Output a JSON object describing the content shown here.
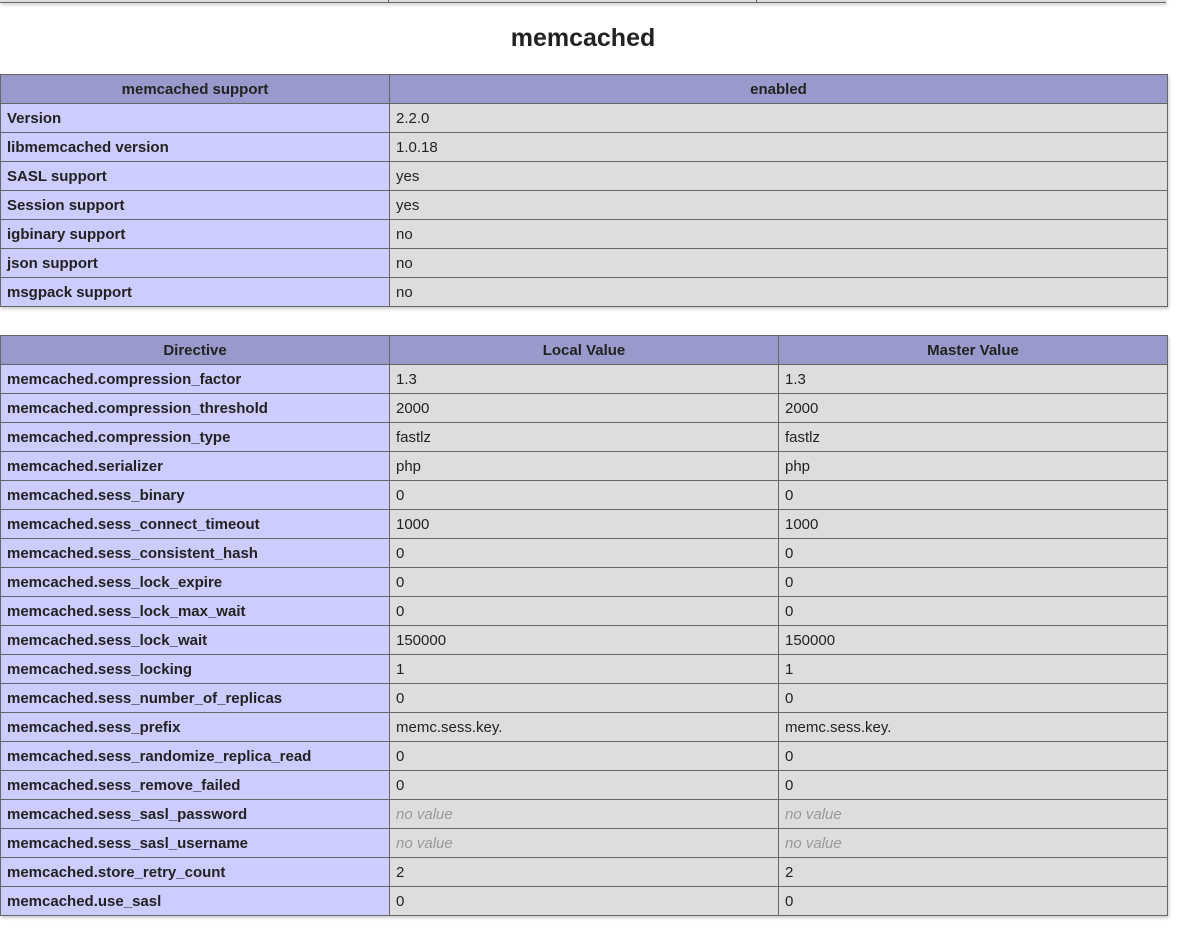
{
  "section_title": "memcached",
  "support_table": {
    "header": [
      "memcached support",
      "enabled"
    ],
    "rows": [
      {
        "name": "Version",
        "value": "2.2.0"
      },
      {
        "name": "libmemcached version",
        "value": "1.0.18"
      },
      {
        "name": "SASL support",
        "value": "yes"
      },
      {
        "name": "Session support",
        "value": "yes"
      },
      {
        "name": "igbinary support",
        "value": "no"
      },
      {
        "name": "json support",
        "value": "no"
      },
      {
        "name": "msgpack support",
        "value": "no"
      }
    ]
  },
  "directive_table": {
    "header": [
      "Directive",
      "Local Value",
      "Master Value"
    ],
    "rows": [
      {
        "directive": "memcached.compression_factor",
        "local": "1.3",
        "master": "1.3"
      },
      {
        "directive": "memcached.compression_threshold",
        "local": "2000",
        "master": "2000"
      },
      {
        "directive": "memcached.compression_type",
        "local": "fastlz",
        "master": "fastlz"
      },
      {
        "directive": "memcached.serializer",
        "local": "php",
        "master": "php"
      },
      {
        "directive": "memcached.sess_binary",
        "local": "0",
        "master": "0"
      },
      {
        "directive": "memcached.sess_connect_timeout",
        "local": "1000",
        "master": "1000"
      },
      {
        "directive": "memcached.sess_consistent_hash",
        "local": "0",
        "master": "0"
      },
      {
        "directive": "memcached.sess_lock_expire",
        "local": "0",
        "master": "0"
      },
      {
        "directive": "memcached.sess_lock_max_wait",
        "local": "0",
        "master": "0"
      },
      {
        "directive": "memcached.sess_lock_wait",
        "local": "150000",
        "master": "150000"
      },
      {
        "directive": "memcached.sess_locking",
        "local": "1",
        "master": "1"
      },
      {
        "directive": "memcached.sess_number_of_replicas",
        "local": "0",
        "master": "0"
      },
      {
        "directive": "memcached.sess_prefix",
        "local": "memc.sess.key.",
        "master": "memc.sess.key."
      },
      {
        "directive": "memcached.sess_randomize_replica_read",
        "local": "0",
        "master": "0"
      },
      {
        "directive": "memcached.sess_remove_failed",
        "local": "0",
        "master": "0"
      },
      {
        "directive": "memcached.sess_sasl_password",
        "local": "no value",
        "master": "no value"
      },
      {
        "directive": "memcached.sess_sasl_username",
        "local": "no value",
        "master": "no value"
      },
      {
        "directive": "memcached.store_retry_count",
        "local": "2",
        "master": "2"
      },
      {
        "directive": "memcached.use_sasl",
        "local": "0",
        "master": "0"
      }
    ]
  },
  "colors": {
    "header_bg": "#9999cc",
    "name_cell_bg": "#ccccff",
    "value_cell_bg": "#dddddd",
    "no_value_text": "#999999"
  }
}
